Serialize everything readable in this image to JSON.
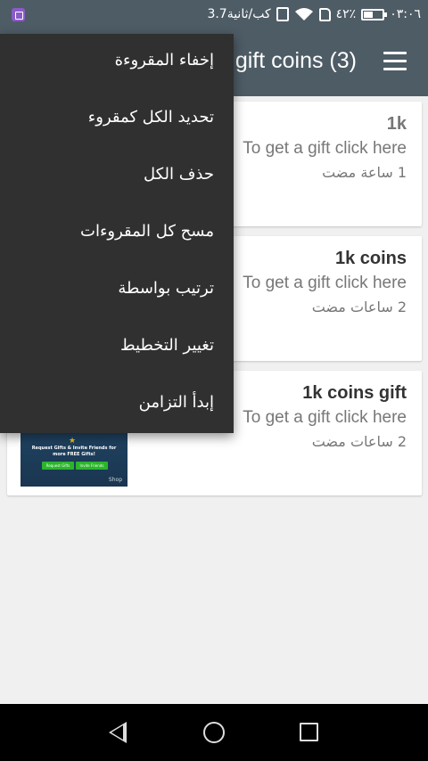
{
  "status_bar": {
    "time": "٠٣:٠٦",
    "battery": "٤٢٪",
    "network": "3.7كب/ثانية",
    "icons": [
      "app-icon",
      "wifi-icon",
      "vibrate-icon",
      "sim-icon",
      "battery-icon"
    ]
  },
  "toolbar": {
    "title": "1k gift coins (3)",
    "menu_icon": "hamburger-icon",
    "background": "#4e5c66"
  },
  "cards": [
    {
      "title": "1k",
      "subtitle": "To get a gift click here",
      "time": "1 ساعة مضت",
      "read": true
    },
    {
      "title": "1k coins",
      "subtitle": "To get a gift click here",
      "time": "2 ساعات مضت",
      "read": false
    },
    {
      "title": "1k coins gift",
      "subtitle": "To get a gift click here",
      "time": "2 ساعات مضت",
      "read": false,
      "thumb": {
        "text": "Request Gifts & Invite Friends for more FREE Gifts!",
        "buttons": [
          "Request Gifts",
          "Invite Friends"
        ],
        "shop": "Shop"
      }
    }
  ],
  "popup_menu": {
    "items": [
      "إخفاء المقروءة",
      "تحديد الكل كمقروء",
      "حذف الكل",
      "مسح كل المقروءات",
      "ترتيب بواسطة",
      "تغيير التخطيط",
      "إبدأ التزامن"
    ],
    "background": "#303030"
  },
  "nav_bar": {
    "icons": [
      "back-icon",
      "home-icon",
      "recent-apps-icon"
    ]
  }
}
